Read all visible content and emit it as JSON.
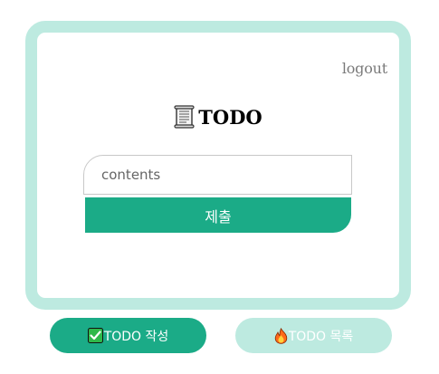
{
  "header": {
    "logout_label": "logout",
    "title": "TODO",
    "title_icon": "scroll-icon"
  },
  "form": {
    "input_placeholder": "contents",
    "input_value": "",
    "submit_label": "제출"
  },
  "nav": {
    "write_icon": "check-icon",
    "write_label": "TODO 작성",
    "list_icon": "fire-icon",
    "list_label": "TODO 목록"
  },
  "colors": {
    "accent": "#1bab87",
    "accent_light": "#bdeae0"
  }
}
